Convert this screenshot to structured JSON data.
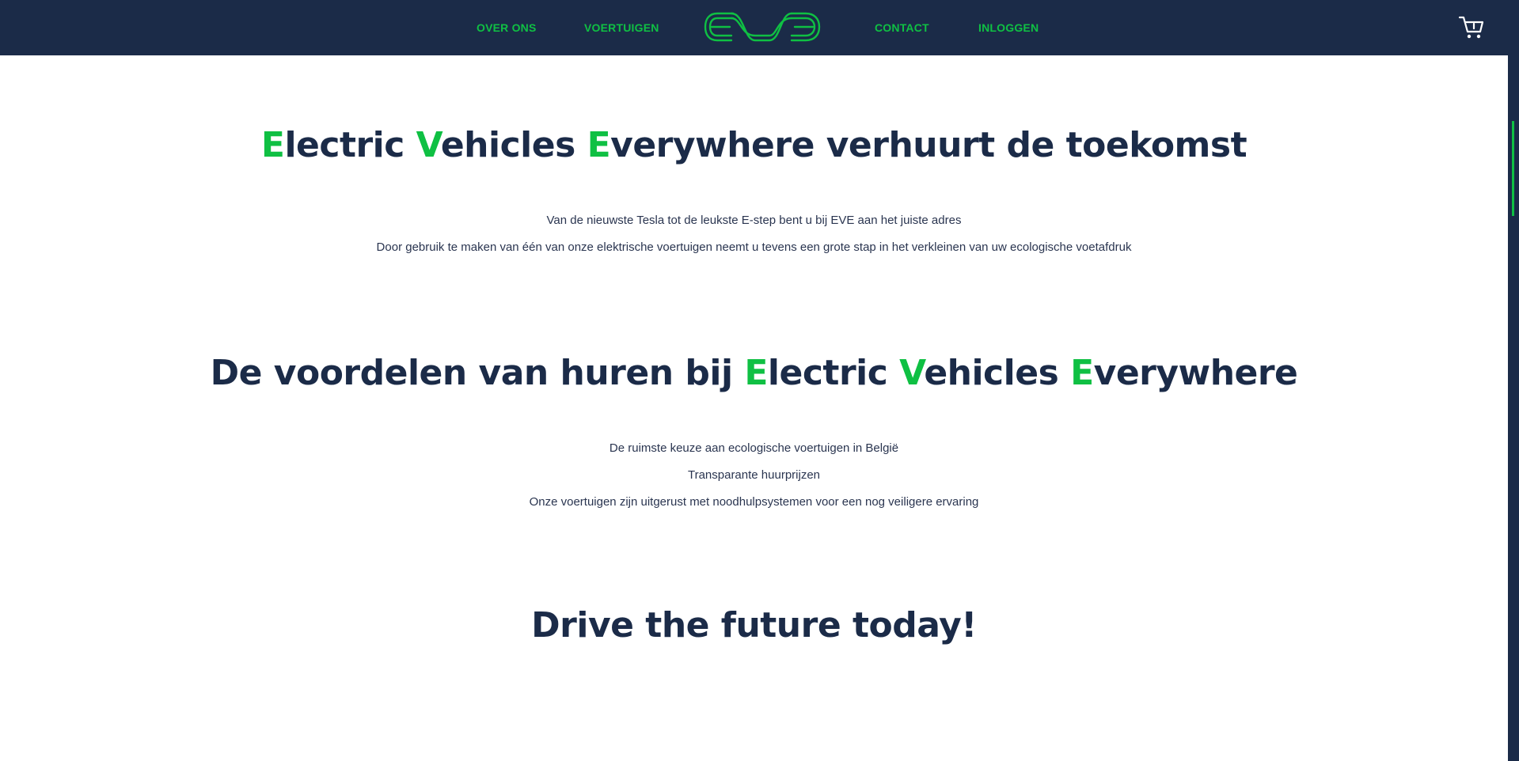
{
  "nav": {
    "links": [
      {
        "label": "OVER ONS"
      },
      {
        "label": "VOERTUIGEN"
      },
      {
        "label": "CONTACT"
      },
      {
        "label": "INLOGGEN"
      }
    ],
    "logo_icon": "eve-logo-icon",
    "cart_icon": "shopping-cart-icon"
  },
  "hero": {
    "heading": {
      "e1": "E",
      "w1": "lectric ",
      "e2": "V",
      "w2": "ehicles ",
      "e3": "E",
      "w3": "verywhere verhuurt de toekomst"
    },
    "lines": [
      "Van de nieuwste Tesla tot de leukste E-step bent u bij EVE aan het juiste adres",
      "Door gebruik te maken van één van onze elektrische voertuigen neemt u tevens een grote stap in het verkleinen van uw ecologische voetafdruk"
    ]
  },
  "benefits": {
    "heading": {
      "prefix": "De voordelen van huren bij ",
      "e1": "E",
      "w1": "lectric ",
      "e2": "V",
      "w2": "ehicles ",
      "e3": "E",
      "w3": "verywhere"
    },
    "items": [
      "De ruimste keuze aan ecologische voertuigen in België",
      "Transparante huurprijzen",
      "Onze voertuigen zijn uitgerust met noodhulpsystemen voor een nog veiligere ervaring"
    ]
  },
  "cta": {
    "heading": "Drive the future today!"
  },
  "colors": {
    "navy": "#1b2b48",
    "accent_green": "#0fc043",
    "background": "#ffffff",
    "body_text": "#2a3550"
  }
}
